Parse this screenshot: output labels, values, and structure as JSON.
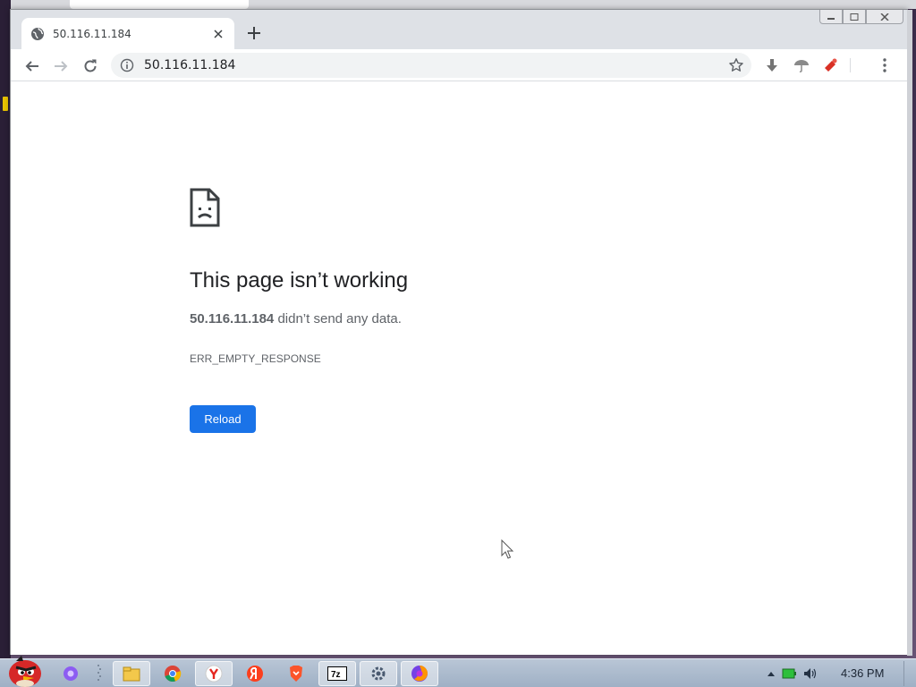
{
  "browser": {
    "tab": {
      "title": "50.116.11.184",
      "favicon": "globe-icon"
    },
    "address_bar": {
      "url": "50.116.11.184"
    }
  },
  "error_page": {
    "title": "This page isn’t working",
    "host": "50.116.11.184",
    "description_suffix": " didn’t send any data.",
    "error_code": "ERR_EMPTY_RESPONSE",
    "reload_label": "Reload"
  },
  "taskbar": {
    "apps": [
      "start-orb-angry-bird",
      "alice-assistant-icon",
      "file-explorer-icon",
      "chrome-icon",
      "yandex-browser-icon",
      "yandex-icon",
      "brave-icon",
      "7zip-icon",
      "settings-tool-icon",
      "firefox-icon"
    ],
    "clock": "4:36 PM"
  },
  "colors": {
    "accent_blue": "#1a73e8",
    "tab_strip": "#dee1e6",
    "omnibox": "#f1f3f4"
  }
}
